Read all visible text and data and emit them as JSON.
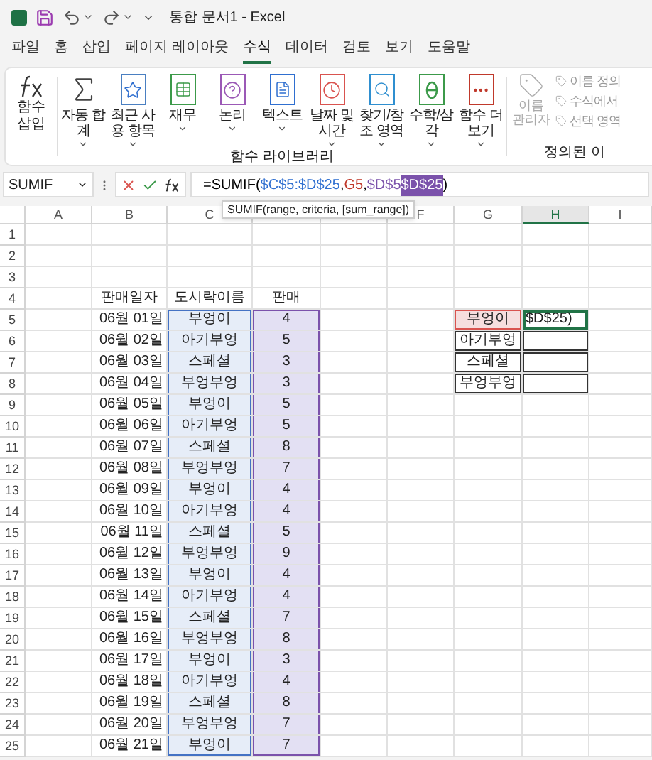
{
  "window": {
    "title": "통합 문서1 - Excel"
  },
  "tabs": [
    {
      "label": "파일",
      "selected": false
    },
    {
      "label": "홈",
      "selected": false
    },
    {
      "label": "삽입",
      "selected": false
    },
    {
      "label": "페이지 레이아웃",
      "selected": false
    },
    {
      "label": "수식",
      "selected": true
    },
    {
      "label": "데이터",
      "selected": false
    },
    {
      "label": "검토",
      "selected": false
    },
    {
      "label": "보기",
      "selected": false
    },
    {
      "label": "도움말",
      "selected": false
    }
  ],
  "ribbon": {
    "insert_function": {
      "label": "함수 삽입"
    },
    "library": {
      "label": "함수 라이브러리",
      "items": [
        {
          "kind": "sum",
          "label": "자동 합계"
        },
        {
          "kind": "star",
          "label": "최근 사용 항목"
        },
        {
          "kind": "finance",
          "label": "재무"
        },
        {
          "kind": "logic",
          "label": "논리"
        },
        {
          "kind": "text",
          "label": "텍스트"
        },
        {
          "kind": "clock",
          "label": "날짜 및 시간"
        },
        {
          "kind": "search",
          "label": "찾기/참조 영역"
        },
        {
          "kind": "math",
          "label": "수학/삼각"
        },
        {
          "kind": "more",
          "label": "함수 더 보기"
        }
      ]
    },
    "names": {
      "label": "정의된 이",
      "manager": {
        "label": "이름 관리자",
        "disabled": true
      },
      "items": [
        {
          "label": "이름 정의",
          "disabled": true
        },
        {
          "label": "수식에서",
          "disabled": true
        },
        {
          "label": "선택 영역",
          "disabled": true
        }
      ]
    }
  },
  "formula_bar": {
    "name_box": "SUMIF",
    "segments": [
      {
        "kind": "plain",
        "text": "=SUMIF(",
        "selected": false
      },
      {
        "kind": "reference",
        "text": "$C$5:$D$25",
        "color": "#2f6fd0",
        "selected": false
      },
      {
        "kind": "plain",
        "text": ",",
        "selected": false
      },
      {
        "kind": "reference",
        "text": "G5",
        "color": "#c0392b",
        "selected": false
      },
      {
        "kind": "plain",
        "text": ",",
        "selected": false
      },
      {
        "kind": "reference",
        "text": "$D$5",
        "color": "#7b52ab",
        "selected": false
      },
      {
        "kind": "reference",
        "text": "$D$25",
        "color": "#7b52ab",
        "selected": true
      },
      {
        "kind": "plain",
        "text": ")",
        "selected": false
      }
    ],
    "tooltip": "SUMIF(range, criteria, [sum_range])"
  },
  "sheet": {
    "column_headers_left": [
      {
        "label": "A",
        "selected": false
      },
      {
        "label": "B",
        "selected": false
      },
      {
        "label": "C",
        "selected": false
      }
    ],
    "column_headers_right": [
      {
        "label": "F",
        "selected": false
      },
      {
        "label": "G",
        "selected": false
      },
      {
        "label": "H",
        "selected": true
      },
      {
        "label": "I",
        "selected": false
      }
    ],
    "row_numbers": [
      "1",
      "2",
      "3",
      "4",
      "5",
      "6",
      "7",
      "8",
      "9",
      "10",
      "11",
      "12",
      "13",
      "14",
      "15",
      "16",
      "17",
      "18",
      "19",
      "20",
      "21",
      "22",
      "23",
      "24",
      "25"
    ],
    "table_header": [
      "판매일자",
      "도시락이름",
      "판매"
    ],
    "sales": [
      [
        "06월 01일",
        "부엉이",
        "4"
      ],
      [
        "06월 02일",
        "아기부엉",
        "5"
      ],
      [
        "06월 03일",
        "스페셜",
        "3"
      ],
      [
        "06월 04일",
        "부엉부엉",
        "3"
      ],
      [
        "06월 05일",
        "부엉이",
        "5"
      ],
      [
        "06월 06일",
        "아기부엉",
        "5"
      ],
      [
        "06월 07일",
        "스페셜",
        "8"
      ],
      [
        "06월 08일",
        "부엉부엉",
        "7"
      ],
      [
        "06월 09일",
        "부엉이",
        "4"
      ],
      [
        "06월 10일",
        "아기부엉",
        "4"
      ],
      [
        "06월 11일",
        "스페셜",
        "5"
      ],
      [
        "06월 12일",
        "부엉부엉",
        "9"
      ],
      [
        "06월 13일",
        "부엉이",
        "4"
      ],
      [
        "06월 14일",
        "아기부엉",
        "4"
      ],
      [
        "06월 15일",
        "스페셜",
        "7"
      ],
      [
        "06월 16일",
        "부엉부엉",
        "8"
      ],
      [
        "06월 17일",
        "부엉이",
        "3"
      ],
      [
        "06월 18일",
        "아기부엉",
        "4"
      ],
      [
        "06월 19일",
        "스페셜",
        "8"
      ],
      [
        "06월 20일",
        "부엉부엉",
        "7"
      ],
      [
        "06월 21일",
        "부엉이",
        "7"
      ]
    ],
    "criteria": [
      {
        "name": "부엉이",
        "value": "$D$25)"
      },
      {
        "name": "아기부엉"
      },
      {
        "name": "스페셜"
      },
      {
        "name": "부엉부엉"
      }
    ]
  }
}
